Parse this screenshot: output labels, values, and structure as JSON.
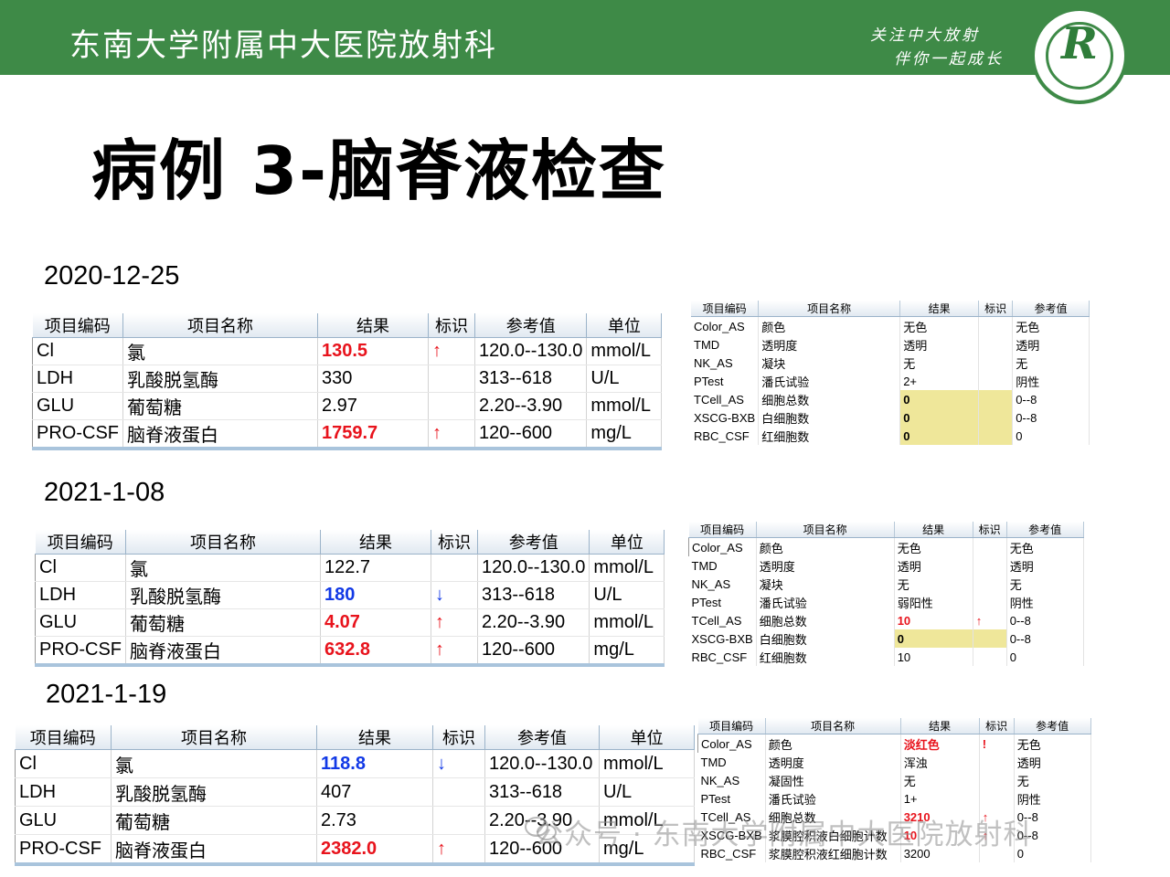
{
  "header": {
    "org_title": "东南大学附属中大医院放射科",
    "slogan_line1": "关注中大放射",
    "slogan_line2": "伴你一起成长",
    "logo_glyph": "R"
  },
  "page_title": "病例 3-脑脊液检查",
  "columns_main": [
    "项目编码",
    "项目名称",
    "结果",
    "标识",
    "参考值",
    "单位"
  ],
  "columns_side": [
    "项目编码",
    "项目名称",
    "结果",
    "标识",
    "参考值"
  ],
  "sections": [
    {
      "date": "2020-12-25",
      "main_rows": [
        {
          "code": "Cl",
          "name": "氯",
          "result": "130.5",
          "flag": "↑",
          "ref": "120.0--130.0",
          "unit": "mmol/L"
        },
        {
          "code": "LDH",
          "name": "乳酸脱氢酶",
          "result": "330",
          "flag": "",
          "ref": "313--618",
          "unit": "U/L"
        },
        {
          "code": "GLU",
          "name": "葡萄糖",
          "result": "2.97",
          "flag": "",
          "ref": "2.20--3.90",
          "unit": "mmol/L"
        },
        {
          "code": "PRO-CSF",
          "name": "脑脊液蛋白",
          "result": "1759.7",
          "flag": "↑",
          "ref": "120--600",
          "unit": "mg/L"
        }
      ],
      "side_rows": [
        {
          "code": "Color_AS",
          "name": "颜色",
          "result": "无色",
          "flag": "",
          "ref": "无色"
        },
        {
          "code": "TMD",
          "name": "透明度",
          "result": "透明",
          "flag": "",
          "ref": "透明"
        },
        {
          "code": "NK_AS",
          "name": "凝块",
          "result": "无",
          "flag": "",
          "ref": "无"
        },
        {
          "code": "PTest",
          "name": "潘氏试验",
          "result": "2+",
          "flag": "",
          "ref": "阴性"
        },
        {
          "code": "TCell_AS",
          "name": "细胞总数",
          "result": "0",
          "flag": "",
          "ref": "0--8"
        },
        {
          "code": "XSCG-BXB",
          "name": "白细胞数",
          "result": "0",
          "flag": "",
          "ref": "0--8"
        },
        {
          "code": "RBC_CSF",
          "name": "红细胞数",
          "result": "0",
          "flag": "",
          "ref": "0"
        }
      ]
    },
    {
      "date": "2021-1-08",
      "main_rows": [
        {
          "code": "Cl",
          "name": "氯",
          "result": "122.7",
          "flag": "",
          "ref": "120.0--130.0",
          "unit": "mmol/L"
        },
        {
          "code": "LDH",
          "name": "乳酸脱氢酶",
          "result": "180",
          "flag": "↓",
          "ref": "313--618",
          "unit": "U/L"
        },
        {
          "code": "GLU",
          "name": "葡萄糖",
          "result": "4.07",
          "flag": "↑",
          "ref": "2.20--3.90",
          "unit": "mmol/L"
        },
        {
          "code": "PRO-CSF",
          "name": "脑脊液蛋白",
          "result": "632.8",
          "flag": "↑",
          "ref": "120--600",
          "unit": "mg/L"
        }
      ],
      "side_rows": [
        {
          "code": "Color_AS",
          "name": "颜色",
          "result": "无色",
          "flag": "",
          "ref": "无色"
        },
        {
          "code": "TMD",
          "name": "透明度",
          "result": "透明",
          "flag": "",
          "ref": "透明"
        },
        {
          "code": "NK_AS",
          "name": "凝块",
          "result": "无",
          "flag": "",
          "ref": "无"
        },
        {
          "code": "PTest",
          "name": "潘氏试验",
          "result": "弱阳性",
          "flag": "",
          "ref": "阴性"
        },
        {
          "code": "TCell_AS",
          "name": "细胞总数",
          "result": "10",
          "flag": "↑",
          "ref": "0--8"
        },
        {
          "code": "XSCG-BXB",
          "name": "白细胞数",
          "result": "0",
          "flag": "",
          "ref": "0--8"
        },
        {
          "code": "RBC_CSF",
          "name": "红细胞数",
          "result": "10",
          "flag": "",
          "ref": "0"
        }
      ]
    },
    {
      "date": "2021-1-19",
      "main_rows": [
        {
          "code": "Cl",
          "name": "氯",
          "result": "118.8",
          "flag": "↓",
          "ref": "120.0--130.0",
          "unit": "mmol/L"
        },
        {
          "code": "LDH",
          "name": "乳酸脱氢酶",
          "result": "407",
          "flag": "",
          "ref": "313--618",
          "unit": "U/L"
        },
        {
          "code": "GLU",
          "name": "葡萄糖",
          "result": "2.73",
          "flag": "",
          "ref": "2.20--3.90",
          "unit": "mmol/L"
        },
        {
          "code": "PRO-CSF",
          "name": "脑脊液蛋白",
          "result": "2382.0",
          "flag": "↑",
          "ref": "120--600",
          "unit": "mg/L"
        }
      ],
      "side_rows": [
        {
          "code": "Color_AS",
          "name": "颜色",
          "result": "淡红色",
          "flag": "!",
          "ref": "无色"
        },
        {
          "code": "TMD",
          "name": "透明度",
          "result": "浑浊",
          "flag": "",
          "ref": "透明"
        },
        {
          "code": "NK_AS",
          "name": "凝固性",
          "result": "无",
          "flag": "",
          "ref": "无"
        },
        {
          "code": "PTest",
          "name": "潘氏试验",
          "result": "1+",
          "flag": "",
          "ref": "阴性"
        },
        {
          "code": "TCell_AS",
          "name": "细胞总数",
          "result": "3210",
          "flag": "↑",
          "ref": "0--8"
        },
        {
          "code": "XSCG-BXB",
          "name": "浆膜腔积液白细胞计数",
          "result": "10",
          "flag": "↑",
          "ref": "0--8"
        },
        {
          "code": "RBC_CSF",
          "name": "浆膜腔积液红细胞计数",
          "result": "3200",
          "flag": "",
          "ref": "0"
        }
      ]
    }
  ],
  "watermark": "公众号 · 东南大学附属中大医院放射科"
}
